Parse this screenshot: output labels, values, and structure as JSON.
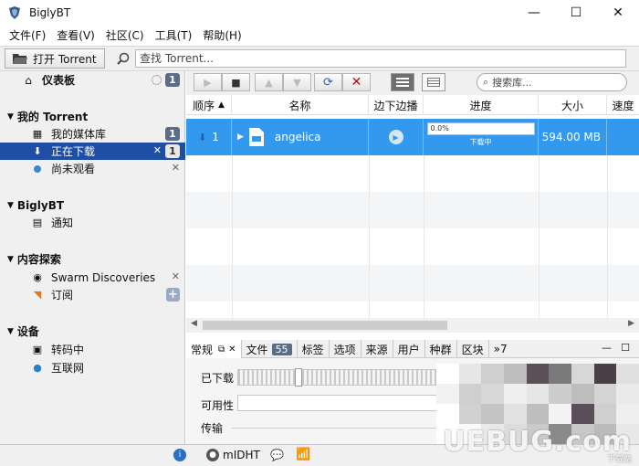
{
  "window": {
    "title": "BiglyBT"
  },
  "menu": [
    "文件(F)",
    "查看(V)",
    "社区(C)",
    "工具(T)",
    "帮助(H)"
  ],
  "toolbar": {
    "open_label": "打开 Torrent",
    "search_placeholder": "查找 Torrent..."
  },
  "sidebar": {
    "dashboard": {
      "label": "仪表板",
      "badge": "1"
    },
    "sections": [
      {
        "title": "我的 Torrent",
        "items": [
          {
            "label": "我的媒体库",
            "badge": "1"
          },
          {
            "label": "正在下载",
            "badge": "1",
            "selected": true
          },
          {
            "label": "尚未观看"
          }
        ]
      },
      {
        "title": "BiglyBT",
        "items": [
          {
            "label": "通知"
          }
        ]
      },
      {
        "title": "内容探索",
        "items": [
          {
            "label": "Swarm Discoveries"
          },
          {
            "label": "订阅"
          }
        ]
      },
      {
        "title": "设备",
        "items": [
          {
            "label": "转码中"
          },
          {
            "label": "互联网"
          }
        ]
      }
    ]
  },
  "library_search": {
    "placeholder": "搜索库..."
  },
  "table": {
    "columns": [
      "顺序",
      "名称",
      "边下边播",
      "进度",
      "大小",
      "速度"
    ],
    "rows": [
      {
        "order": "1",
        "name": "angelica",
        "progress_percent": 0.0,
        "progress_label": "0.0%",
        "status": "下载中",
        "size": "594.00 MB"
      }
    ]
  },
  "tabs": [
    "常规",
    "文件",
    "标签",
    "选项",
    "来源",
    "用户",
    "种群",
    "区块"
  ],
  "tabs_files_count": "55",
  "tabs_overflow": "»7",
  "panel": {
    "downloaded_label": "已下载",
    "availability_label": "可用性",
    "transfer_label": "传输"
  },
  "status": {
    "dht_label": "mIDHT"
  },
  "watermark": {
    "text": "UEBUG.com",
    "sub": "下载站"
  },
  "colors": {
    "selected_row": "#3399ee",
    "sidebar_selected": "#1f4fa4",
    "badge": "#5a6c86"
  }
}
